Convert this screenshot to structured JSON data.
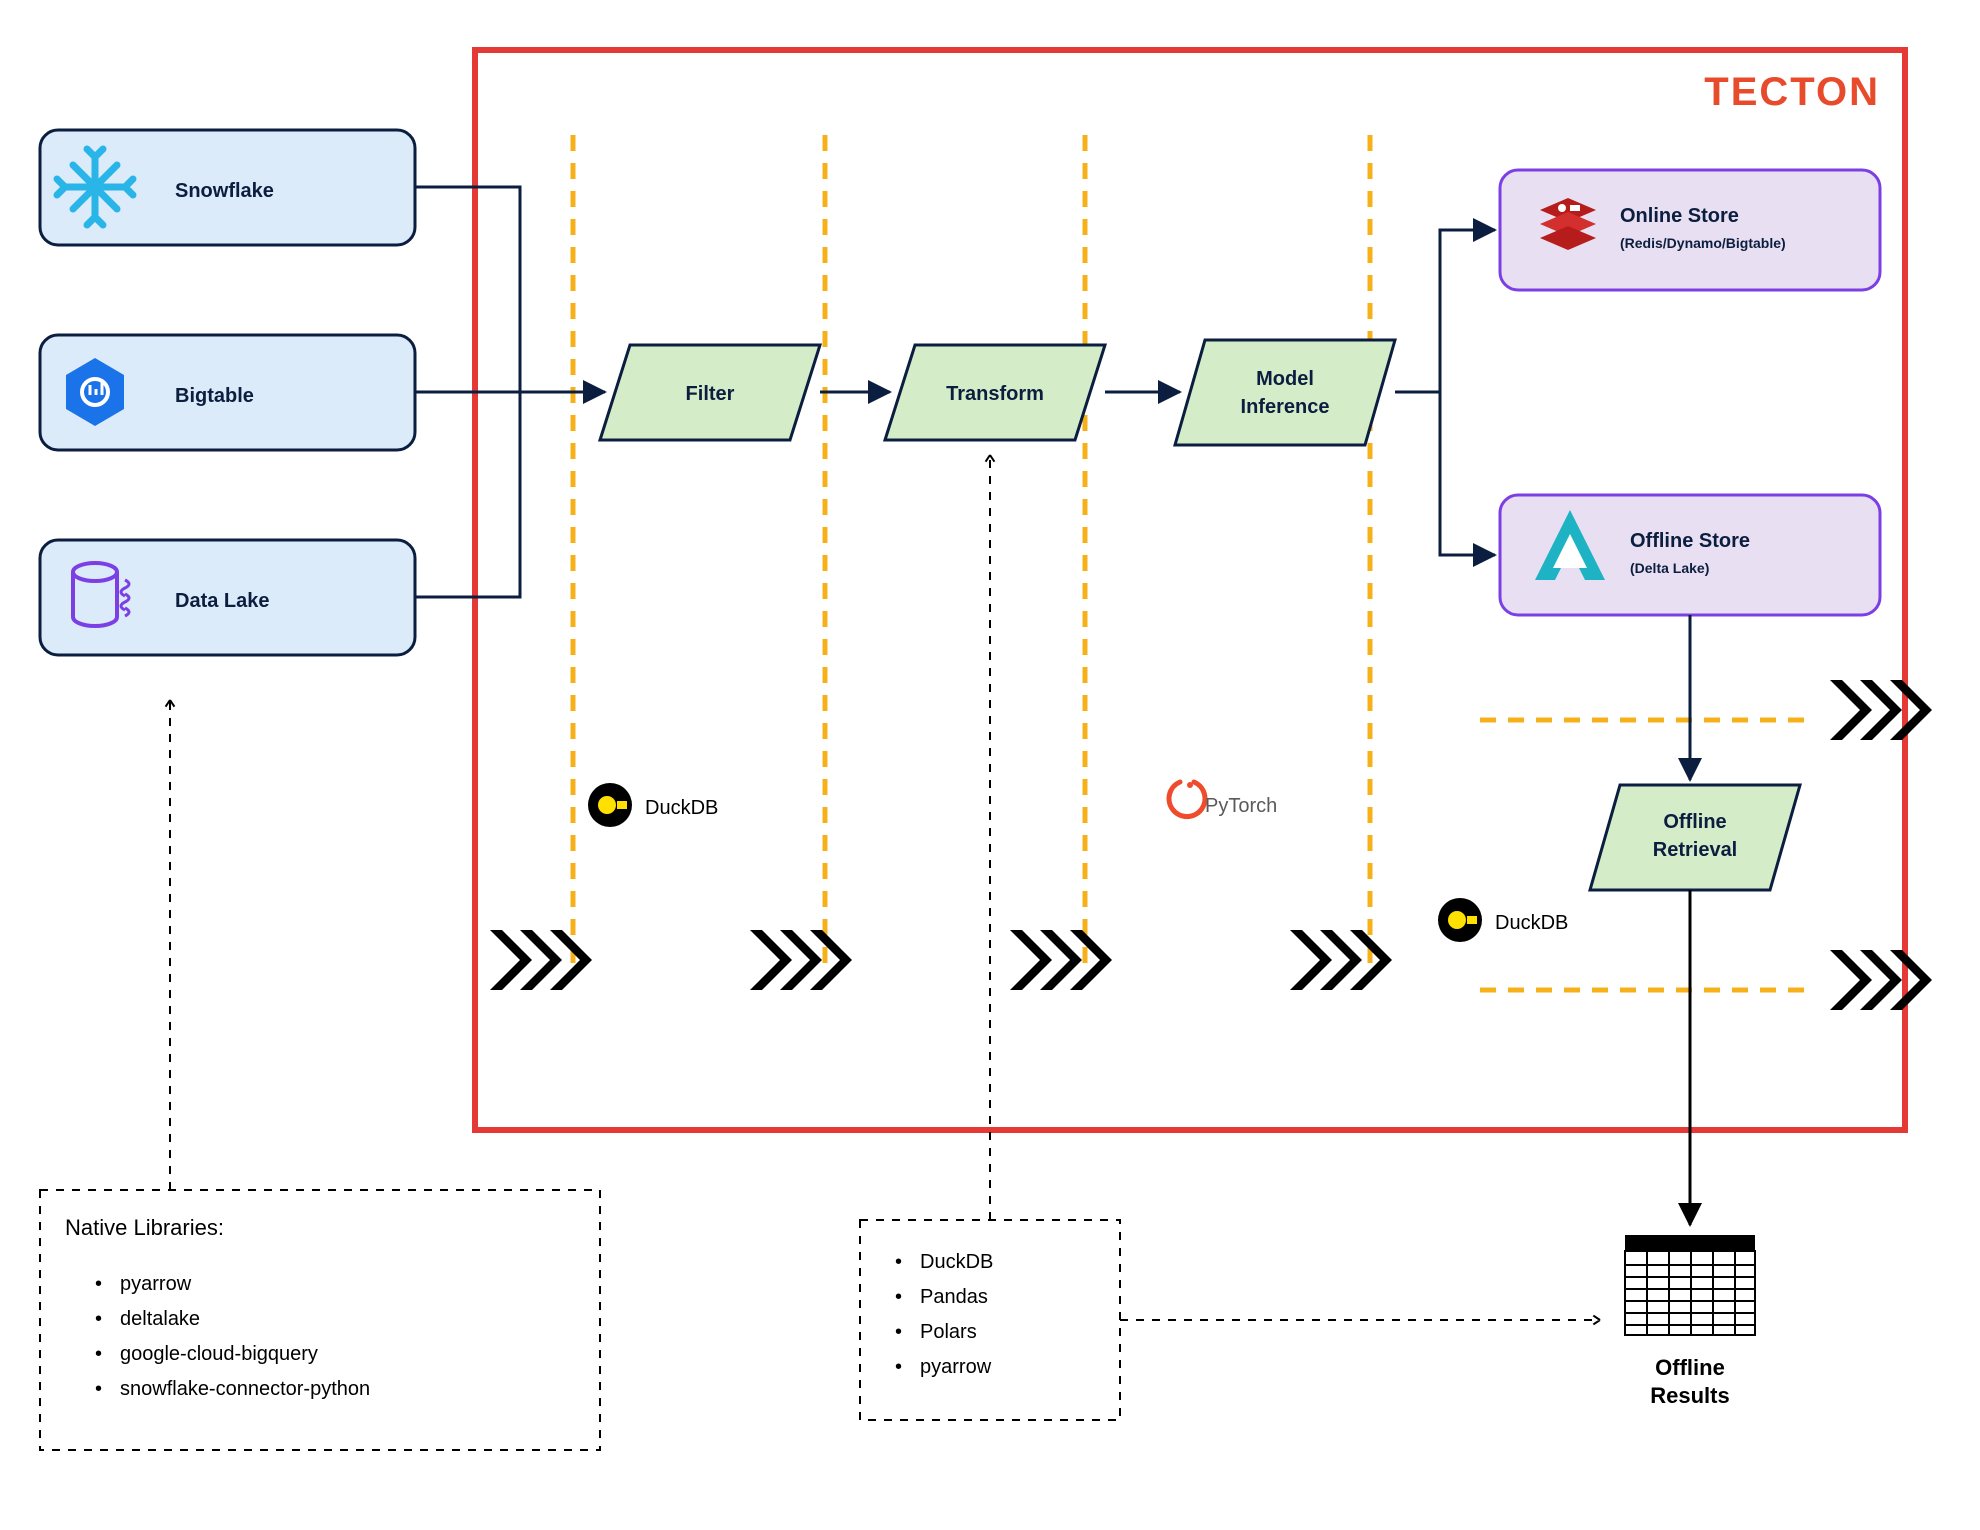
{
  "brand": "TECTON",
  "sources": {
    "snowflake": "Snowflake",
    "bigtable": "Bigtable",
    "datalake": "Data Lake"
  },
  "steps": {
    "filter": "Filter",
    "transform": "Transform",
    "inference_l1": "Model",
    "inference_l2": "Inference",
    "retrieval_l1": "Offline",
    "retrieval_l2": "Retrieval"
  },
  "stores": {
    "online_title": "Online Store",
    "online_sub": "(Redis/Dynamo/Bigtable)",
    "offline_title": "Offline Store",
    "offline_sub": "(Delta Lake)"
  },
  "tech": {
    "duckdb1": "DuckDB",
    "pytorch": "PyTorch",
    "duckdb2": "DuckDB"
  },
  "results": {
    "line1": "Offline",
    "line2": "Results"
  },
  "native_box": {
    "title": "Native Libraries:",
    "items": [
      "pyarrow",
      "deltalake",
      "google-cloud-bigquery",
      "snowflake-connector-python"
    ]
  },
  "transform_box": {
    "items": [
      "DuckDB",
      "Pandas",
      "Polars",
      "pyarrow"
    ]
  }
}
